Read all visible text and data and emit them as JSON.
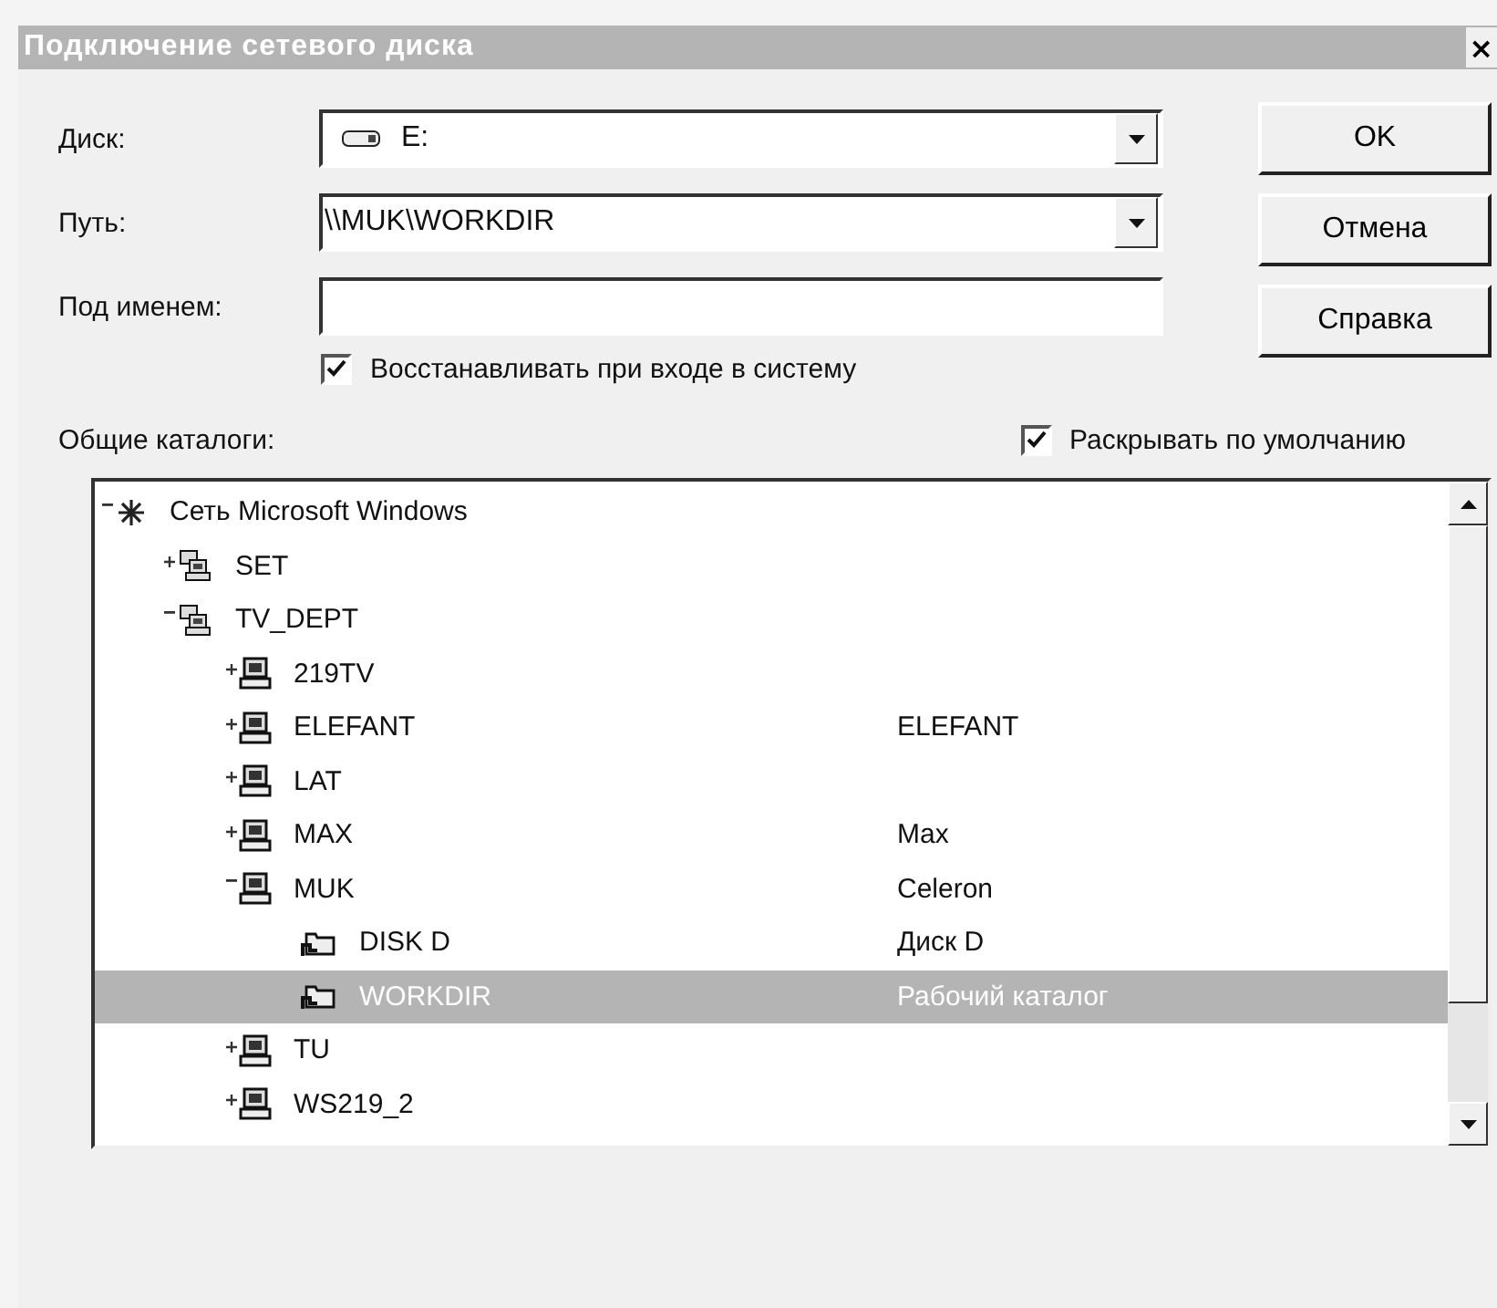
{
  "window": {
    "title": "Подключение сетевого диска",
    "close": "×"
  },
  "fields": [
    {
      "kind": "combo",
      "label": "Диск:",
      "value": "E:",
      "drive_icon": true
    },
    {
      "kind": "combo",
      "label": "Путь:",
      "value": "\\\\MUK\\WORKDIR"
    },
    {
      "kind": "text",
      "label": "Под именем:"
    }
  ],
  "reconnect": {
    "label": "Восстанавливать при входе в систему",
    "checked": true
  },
  "buttons": [
    "OK",
    "Отмена",
    "Справка"
  ],
  "shared_label": "Общие каталоги:",
  "expand_default": {
    "label": "Раскрывать по умолчанию",
    "checked": true
  },
  "tree": [
    {
      "kind": "network",
      "label": "Сеть Microsoft Windows",
      "expanded": true,
      "selected": false,
      "children": [
        {
          "kind": "workgroup",
          "label": "SET",
          "expanded": false,
          "selected": false
        },
        {
          "kind": "workgroup",
          "label": "TV_DEPT",
          "expanded": true,
          "selected": false,
          "children": [
            {
              "kind": "computer",
              "label": "219TV",
              "expanded": false,
              "selected": false
            },
            {
              "kind": "computer",
              "label": "ELEFANT",
              "comment": "ELEFANT",
              "expanded": false,
              "selected": false
            },
            {
              "kind": "computer",
              "label": "LAT",
              "expanded": false,
              "selected": false
            },
            {
              "kind": "computer",
              "label": "MAX",
              "comment": "Max",
              "expanded": false,
              "selected": false
            },
            {
              "kind": "computer",
              "label": "MUK",
              "comment": "Celeron",
              "expanded": true,
              "selected": false,
              "children": [
                {
                  "kind": "share",
                  "label": "DISK D",
                  "comment": "Диск D",
                  "selected": false
                },
                {
                  "kind": "share",
                  "label": "WORKDIR",
                  "comment": "Рабочий каталог",
                  "selected": true
                }
              ]
            },
            {
              "kind": "computer",
              "label": "TU",
              "expanded": false,
              "selected": false
            },
            {
              "kind": "computer",
              "label": "WS219_2",
              "expanded": false,
              "selected": false
            }
          ]
        }
      ]
    }
  ]
}
